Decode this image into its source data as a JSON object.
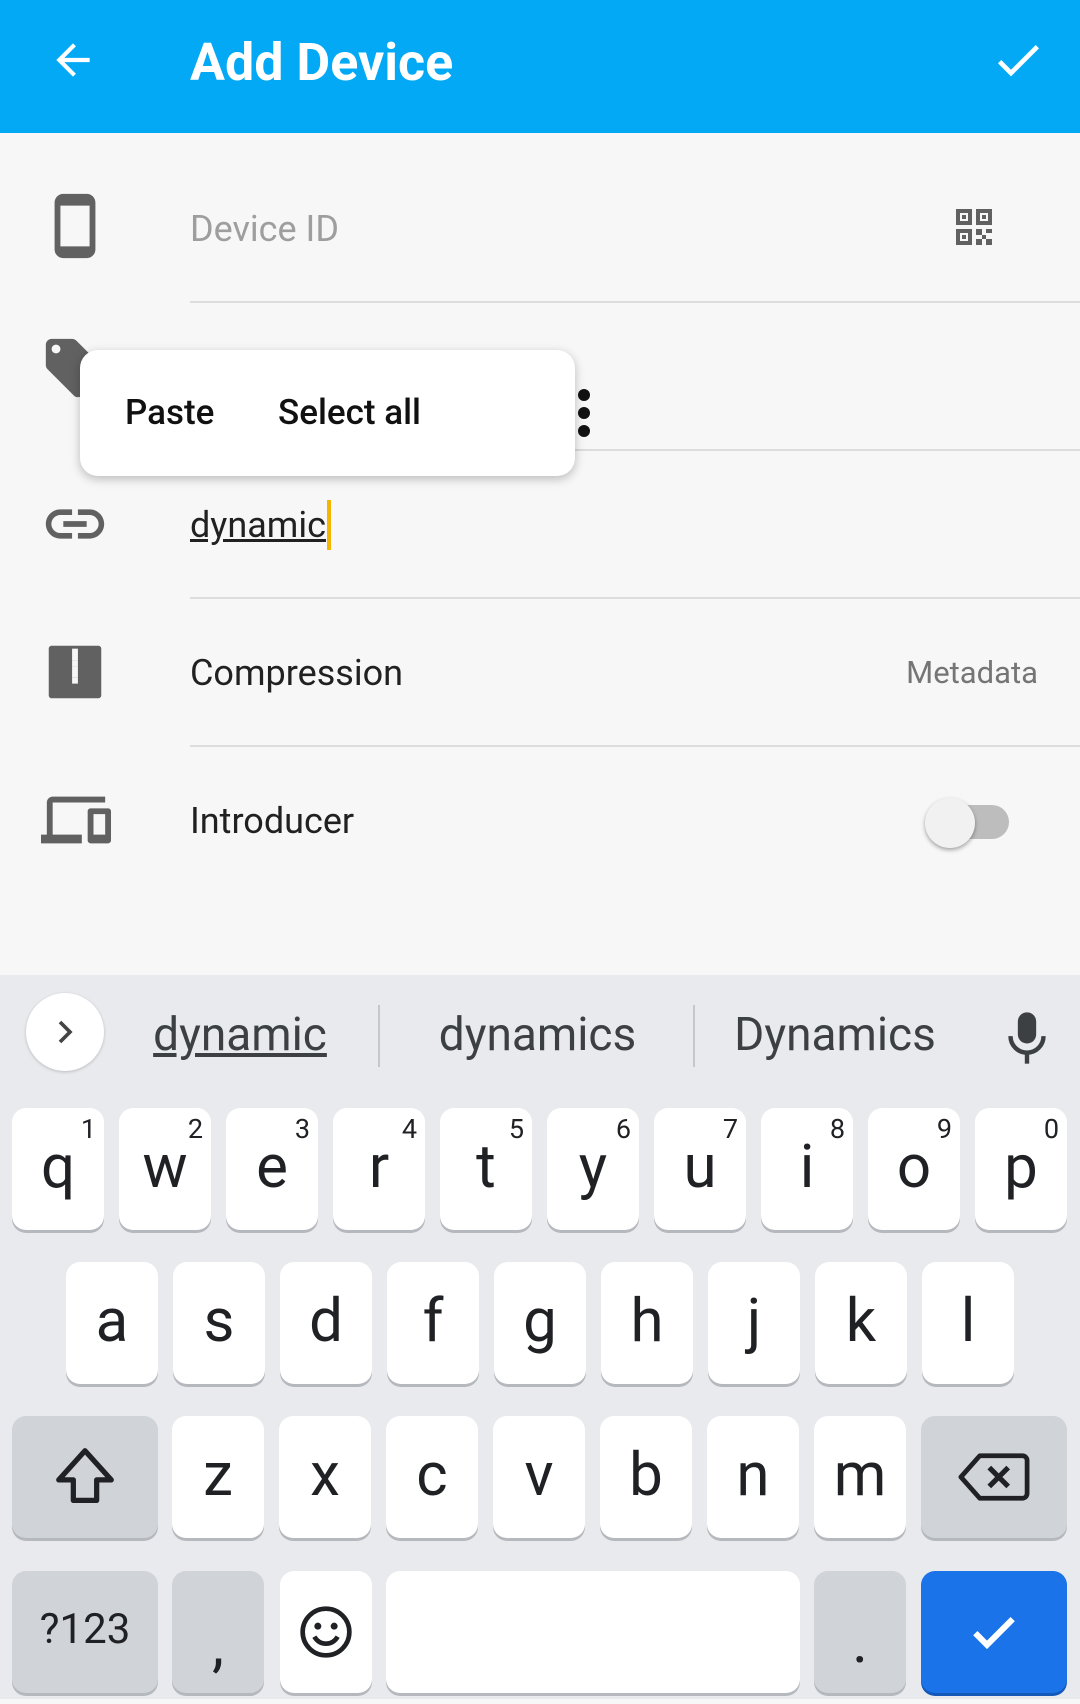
{
  "appbar": {
    "title": "Add Device"
  },
  "form": {
    "device_id_placeholder": "Device ID",
    "address_value": "dynamic",
    "compression_label": "Compression",
    "compression_value": "Metadata",
    "introducer_label": "Introducer",
    "introducer_enabled": false
  },
  "popup": {
    "paste": "Paste",
    "select_all": "Select all"
  },
  "keyboard": {
    "suggestions": [
      "dynamic",
      "dynamics",
      "Dynamics"
    ],
    "row1": [
      {
        "k": "q",
        "h": "1"
      },
      {
        "k": "w",
        "h": "2"
      },
      {
        "k": "e",
        "h": "3"
      },
      {
        "k": "r",
        "h": "4"
      },
      {
        "k": "t",
        "h": "5"
      },
      {
        "k": "y",
        "h": "6"
      },
      {
        "k": "u",
        "h": "7"
      },
      {
        "k": "i",
        "h": "8"
      },
      {
        "k": "o",
        "h": "9"
      },
      {
        "k": "p",
        "h": "0"
      }
    ],
    "row2": [
      "a",
      "s",
      "d",
      "f",
      "g",
      "h",
      "j",
      "k",
      "l"
    ],
    "row3": [
      "z",
      "x",
      "c",
      "v",
      "b",
      "n",
      "m"
    ],
    "symbols_label": "?123",
    "comma": ",",
    "period": "."
  },
  "colors": {
    "appbar": "#03a9f4",
    "cursor": "#f5b400",
    "enter_key": "#1a73e8"
  }
}
